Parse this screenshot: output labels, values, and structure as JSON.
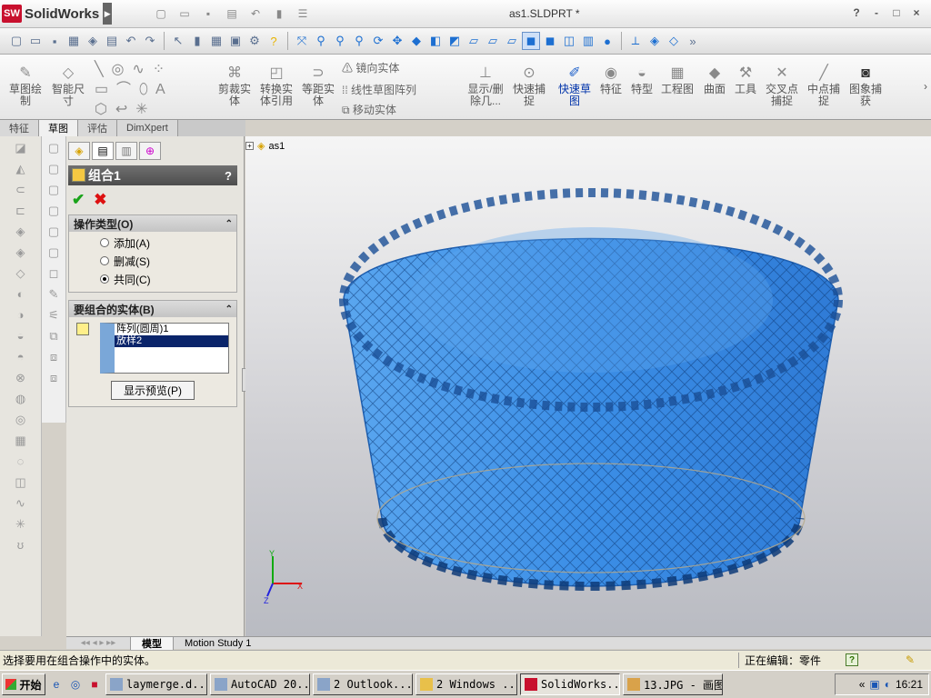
{
  "app": {
    "brand": "SolidWorks",
    "doc_title": "as1.SLDPRT *"
  },
  "window_controls": [
    "?",
    "-",
    "□",
    "×"
  ],
  "command_manager": {
    "buttons": [
      {
        "id": "sketch",
        "label": "草图绘\n制",
        "icon": "sketch-icon"
      },
      {
        "id": "smart-dim",
        "label": "智能尺\n寸",
        "icon": "dimension-icon"
      },
      {
        "id": "trim",
        "label": "剪裁实\n体",
        "icon": "trim-icon"
      },
      {
        "id": "convert",
        "label": "转换实\n体引用",
        "icon": "convert-icon"
      },
      {
        "id": "offset",
        "label": "等距实\n体",
        "icon": "offset-icon"
      },
      {
        "id": "show-delete",
        "label": "显示/删\n除几...",
        "icon": "relations-icon"
      },
      {
        "id": "quick-snap",
        "label": "快速捕\n捉",
        "icon": "snap-icon"
      },
      {
        "id": "rapid-sketch",
        "label": "快速草\n图",
        "icon": "rapid-sketch-icon"
      },
      {
        "id": "features",
        "label": "特征",
        "icon": "features-icon"
      },
      {
        "id": "shapes",
        "label": "特型",
        "icon": "shapes-icon"
      },
      {
        "id": "drawing",
        "label": "工程图",
        "icon": "drawing-icon"
      },
      {
        "id": "surfaces",
        "label": "曲面",
        "icon": "surface-icon"
      },
      {
        "id": "tools",
        "label": "工具",
        "icon": "tools-icon"
      },
      {
        "id": "intersect-snap",
        "label": "交叉点\n捕捉",
        "icon": "intersect-icon"
      },
      {
        "id": "midpoint-snap",
        "label": "中点捕\n捉",
        "icon": "midpoint-icon"
      },
      {
        "id": "image-capture",
        "label": "图象捕\n获",
        "icon": "camera-icon"
      }
    ],
    "small_rows": [
      "镜向实体",
      "线性草图阵列",
      "移动实体"
    ]
  },
  "manager_tabs": [
    "特征",
    "草图",
    "评估",
    "DimXpert"
  ],
  "property_manager": {
    "title": "组合1",
    "help": "?",
    "ok": "✔",
    "cancel": "✖",
    "op_group": {
      "title": "操作类型(O)",
      "options": [
        {
          "label": "添加(A)",
          "checked": false
        },
        {
          "label": "删减(S)",
          "checked": false
        },
        {
          "label": "共同(C)",
          "checked": true
        }
      ]
    },
    "bodies_group": {
      "title": "要组合的实体(B)",
      "items": [
        {
          "label": "阵列(圆周)1",
          "selected": false
        },
        {
          "label": "放样2",
          "selected": true
        }
      ],
      "preview_button": "显示预览(P)"
    }
  },
  "feature_tree": {
    "root": "as1"
  },
  "triad": {
    "x": "X",
    "y": "Y",
    "z": "Z"
  },
  "bottom_tabs": [
    "模型",
    "Motion Study 1"
  ],
  "status": {
    "message": "选择要用在组合操作中的实体。",
    "editing": "正在编辑：零件",
    "help": "?"
  },
  "taskbar": {
    "start": "开始",
    "buttons": [
      {
        "label": "laymerge.d...",
        "active": false
      },
      {
        "label": "AutoCAD 20...",
        "active": false
      },
      {
        "label": "2 Outlook...",
        "active": false
      },
      {
        "label": "2 Windows ...",
        "active": false
      },
      {
        "label": "SolidWorks...",
        "active": true
      },
      {
        "label": "13.JPG - 画图",
        "active": false
      }
    ],
    "clock": "16:21"
  },
  "colors": {
    "model": "#3d8fe6",
    "model_dark": "#1e5fb0"
  }
}
